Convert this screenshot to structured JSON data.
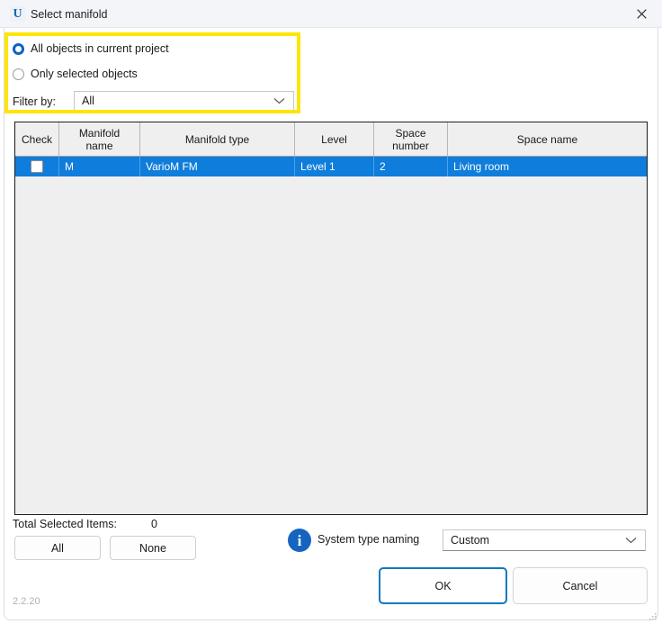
{
  "window": {
    "title": "Select manifold",
    "app_icon": "U",
    "icon_name": "uponor-logo-icon",
    "close_icon": "close-icon",
    "version": "2.2.20"
  },
  "options": {
    "radios": [
      {
        "label": "All objects in current project",
        "selected": true
      },
      {
        "label": "Only selected objects",
        "selected": false
      }
    ],
    "filter": {
      "label": "Filter by:",
      "value": "All",
      "options": [
        "All"
      ],
      "chevron_icon": "chevron-down-icon"
    },
    "highlight_color": "#FFE500"
  },
  "table": {
    "columns": [
      "Check",
      "Manifold\nname",
      "Manifold type",
      "Level",
      "Space\nnumber",
      "Space name"
    ],
    "column_labels": {
      "check": "Check",
      "manifold_name_line1": "Manifold",
      "manifold_name_line2": "name",
      "manifold_type": "Manifold type",
      "level": "Level",
      "space_number_line1": "Space",
      "space_number_line2": "number",
      "space_name": "Space name"
    },
    "rows": [
      {
        "checked": false,
        "manifold_name": "M",
        "manifold_type": "VarioM FM",
        "level": "Level 1",
        "space_number": "2",
        "space_name": "Living room",
        "selected": true
      }
    ],
    "selection_color": "#0F7DDB"
  },
  "footer": {
    "total_label": "Total Selected Items:",
    "total_value": "0",
    "all_button": "All",
    "none_button": "None",
    "info_icon": "info-icon",
    "info_glyph": "i",
    "naming_label": "System type naming",
    "naming_value": "Custom",
    "naming_options": [
      "Custom"
    ],
    "ok_button": "OK",
    "cancel_button": "Cancel",
    "ok_accent_color": "#0B7AC0"
  }
}
